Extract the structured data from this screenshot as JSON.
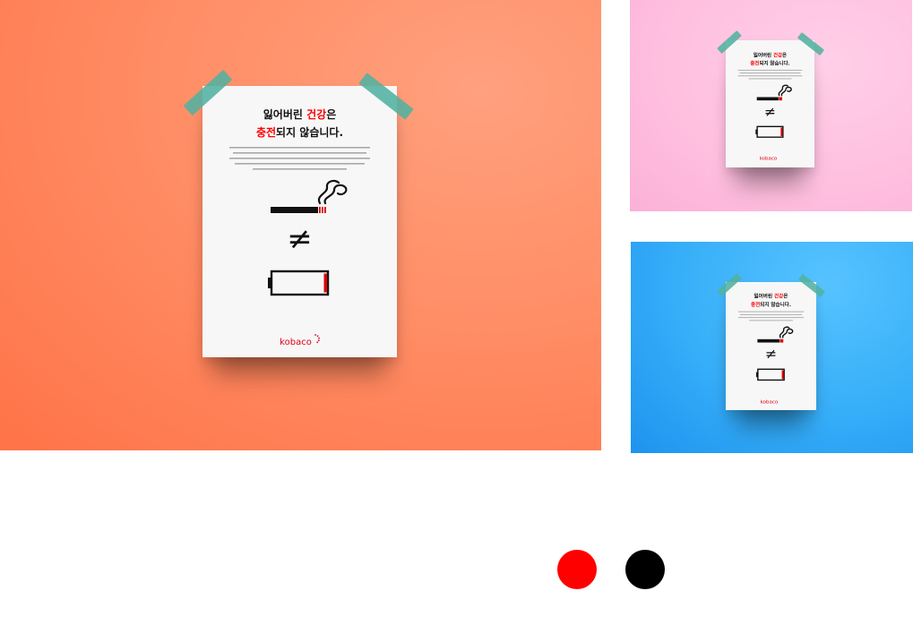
{
  "poster": {
    "headline_line1_pre": "잃어버린 ",
    "headline_line1_accent": "건강",
    "headline_line1_post": "은",
    "headline_line2_accent": "충전",
    "headline_line2_post": "되지 않습니다.",
    "not_equal_symbol": "≠",
    "brand_logo": "kobaco"
  },
  "colors": {
    "accent_red": "#ff0000",
    "text_black": "#000000",
    "orange_background": "#ff8e66",
    "pink_background": "#ffc0e0",
    "blue_background": "#36aef8",
    "tape_teal": "#52b2a0"
  },
  "swatches": [
    {
      "name": "red",
      "color": "#ff0000"
    },
    {
      "name": "black",
      "color": "#000000"
    }
  ]
}
